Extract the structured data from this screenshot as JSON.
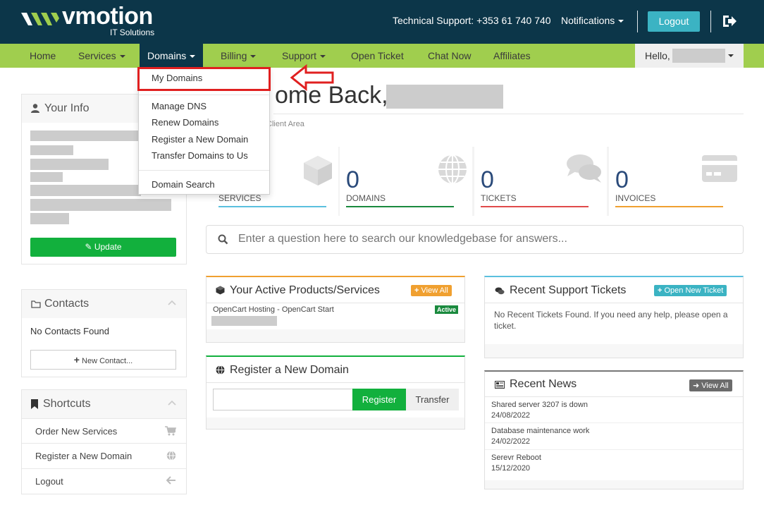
{
  "header": {
    "logo_text": "vmotion",
    "logo_sub": "IT Solutions",
    "support": "Technical Support: +353 61 740 740",
    "notifications": "Notifications",
    "logout": "Logout",
    "colors": {
      "bg": "#0c3649",
      "accent": "#3bb3c3"
    }
  },
  "nav": {
    "items": [
      {
        "label": "Home"
      },
      {
        "label": "Services"
      },
      {
        "label": "Domains"
      },
      {
        "label": "Billing"
      },
      {
        "label": "Support"
      },
      {
        "label": "Open Ticket"
      },
      {
        "label": "Chat Now"
      },
      {
        "label": "Affiliates"
      }
    ],
    "hello": "Hello,",
    "color": "#a0ce4e"
  },
  "dropdown": {
    "items": [
      "My Domains",
      "Manage DNS",
      "Renew Domains",
      "Register a New Domain",
      "Transfer Domains to Us",
      "Domain Search"
    ]
  },
  "welcome": {
    "title": "ome Back,",
    "breadcrumb": "Client Area"
  },
  "stats": [
    {
      "value": "",
      "label": "SERVICES",
      "color": "#5bc0de",
      "icon": "cube-icon"
    },
    {
      "value": "0",
      "label": "DOMAINS",
      "color": "#1a8a3e",
      "icon": "globe-icon"
    },
    {
      "value": "0",
      "label": "TICKETS",
      "color": "#e04a4a",
      "icon": "chat-icon"
    },
    {
      "value": "0",
      "label": "INVOICES",
      "color": "#f0a030",
      "icon": "credit-card-icon"
    }
  ],
  "kb_search": {
    "placeholder": "Enter a question here to search our knowledgebase for answers..."
  },
  "your_info": {
    "title": "Your Info",
    "update": "Update"
  },
  "contacts": {
    "title": "Contacts",
    "empty": "No Contacts Found",
    "new_contact": "New Contact..."
  },
  "shortcuts": {
    "title": "Shortcuts",
    "items": [
      {
        "label": "Order New Services",
        "icon": "cart-icon"
      },
      {
        "label": "Register a New Domain",
        "icon": "globe-icon"
      },
      {
        "label": "Logout",
        "icon": "arrow-left-icon"
      }
    ]
  },
  "products": {
    "title": "Your Active Products/Services",
    "view_all": "View All",
    "item_name": "OpenCart Hosting - OpenCart Start",
    "item_status": "Active"
  },
  "register_domain": {
    "title": "Register a New Domain",
    "register": "Register",
    "transfer": "Transfer"
  },
  "tickets": {
    "title": "Recent Support Tickets",
    "open_new": "Open New Ticket",
    "empty_text": "No Recent Tickets Found. If you need any help, please open a ticket."
  },
  "news": {
    "title": "Recent News",
    "view_all": "View All",
    "items": [
      {
        "title": "Shared server 3207 is down",
        "date": "24/08/2022"
      },
      {
        "title": "Database maintenance work",
        "date": "24/02/2022"
      },
      {
        "title": "Serevr Reboot",
        "date": "15/12/2020"
      }
    ]
  }
}
